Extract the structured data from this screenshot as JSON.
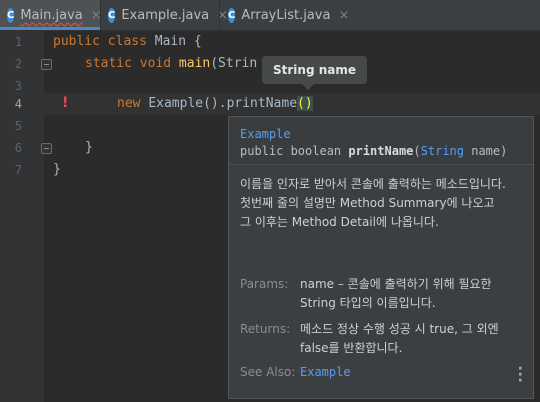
{
  "tabs": [
    {
      "icon": "C",
      "label": "Main.java",
      "close": "×"
    },
    {
      "icon": "C",
      "label": "Example.java",
      "close": "×"
    },
    {
      "icon": "C",
      "label": "ArrayList.java",
      "close": "×"
    }
  ],
  "gutter": {
    "lines": [
      "1",
      "2",
      "3",
      "4",
      "5",
      "6",
      "7"
    ]
  },
  "code": {
    "line1": {
      "kw": "public class ",
      "name": "Main {"
    },
    "line2": {
      "kw": "static void ",
      "fn": "main",
      "rest": "(Strin"
    },
    "line4": {
      "kw": "new ",
      "text": "Example().printName",
      "paren_open": "(",
      "paren_close": ")"
    },
    "line6": "}",
    "line7": "}"
  },
  "hint": {
    "text": "String name"
  },
  "doc": {
    "class_name": "Example",
    "signature": {
      "modifiers": "public boolean ",
      "method": "printName",
      "open": "(",
      "param_type": "String",
      "param_name": " name)"
    },
    "description": "이름을 인자로 받아서 콘솔에 출력하는 메소드입니다. 첫번째 줄의 설명만 Method Summary에 나오고 그 이후는 Method Detail에 나옵니다.",
    "params_label": "Params:",
    "params_value": "name – 콘솔에 출력하기 위해 필요한 String 타입의 이름입니다.",
    "returns_label": "Returns:",
    "returns_value": "메소드 정상 수행 성공 시 true, 그 외엔 false를 반환합니다.",
    "see_also_label": "See Also:",
    "see_also_value": "Example"
  },
  "colors": {
    "accent": "#4a88c7",
    "error": "#e5484d",
    "link": "#589df6"
  }
}
